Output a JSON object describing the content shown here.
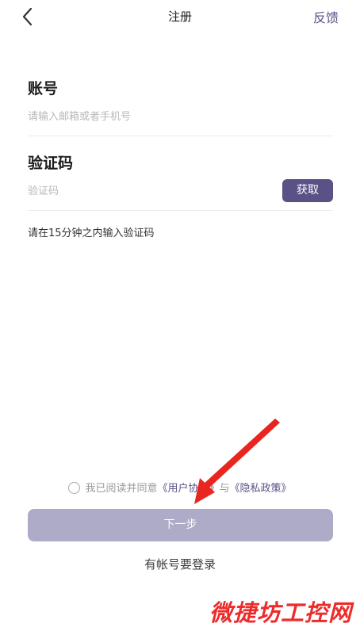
{
  "header": {
    "title": "注册",
    "feedback_label": "反馈"
  },
  "account": {
    "label": "账号",
    "placeholder": "请输入邮箱或者手机号"
  },
  "code": {
    "label": "验证码",
    "placeholder": "验证码",
    "get_button": "获取",
    "hint": "请在15分钟之内输入验证码"
  },
  "agreement": {
    "prefix": "我已阅读并同意",
    "user_agreement": "《用户协议》",
    "conjunction": "与",
    "privacy_policy": "《隐私政策》",
    "checked": false
  },
  "next_button": "下一步",
  "login_link": "有帐号要登录",
  "watermark": "微捷坊工控网",
  "colors": {
    "accent": "#5a5187",
    "button_disabled": "#adabc7",
    "annotation_arrow": "#e8261f",
    "watermark": "#ee2b2b"
  }
}
